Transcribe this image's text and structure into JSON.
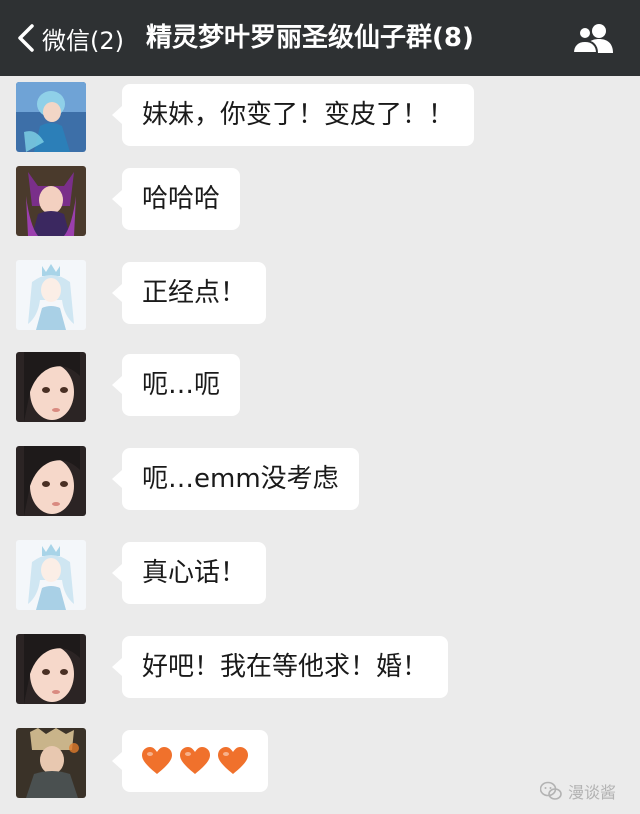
{
  "header": {
    "back_label": "微信(2)",
    "title": "精灵梦叶罗丽圣级仙子群(8)",
    "back_icon": "chevron-left-icon",
    "group_icon": "group-members-icon"
  },
  "messages": [
    {
      "text": "妹妹，你变了！变皮了！！"
    },
    {
      "text": "哈哈哈"
    },
    {
      "text": "正经点！"
    },
    {
      "text": "呃…呃"
    },
    {
      "text": "呃…emm没考虑"
    },
    {
      "text": "真心话！"
    },
    {
      "text": "好吧！我在等他求！婚！"
    },
    {
      "text": "",
      "emoji": [
        "orange-heart",
        "orange-heart",
        "orange-heart"
      ]
    }
  ],
  "watermark": {
    "text": "漫谈酱",
    "icon": "wechat-icon"
  },
  "colors": {
    "header_bg": "#2e3133",
    "chat_bg": "#ebebeb",
    "bubble": "#ffffff",
    "heart": "#f0712c"
  }
}
